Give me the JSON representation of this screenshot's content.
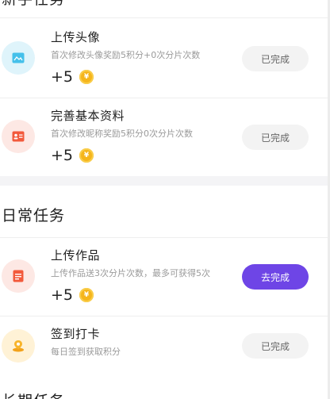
{
  "sections": {
    "newbie_title": "新手任务",
    "daily_title": "日常任务",
    "longterm_title": "长期任务"
  },
  "newbie_tasks": [
    {
      "title": "上传头像",
      "desc": "首次修改头像奖励5积分+0次分片次数",
      "reward": "+5",
      "button": "已完成",
      "icon": "image-icon",
      "status": "done"
    },
    {
      "title": "完善基本资料",
      "desc": "首次修改昵称奖励5积分0次分片次数",
      "reward": "+5",
      "button": "已完成",
      "icon": "profile-card-icon",
      "status": "done"
    }
  ],
  "daily_tasks": [
    {
      "title": "上传作品",
      "desc": "上传作品送3次分片次数，最多可获得5次",
      "reward": "+5",
      "button": "去完成",
      "icon": "document-icon",
      "status": "todo"
    },
    {
      "title": "签到打卡",
      "desc": "每日签到获取积分",
      "button": "已完成",
      "icon": "checkin-pin-icon",
      "status": "done"
    }
  ],
  "coin_symbol": "¥",
  "colors": {
    "accent": "#6e45e6",
    "coin": "#f5b51c",
    "done_button_bg": "#f3f3f3",
    "section_gap": "#f4f4f6"
  }
}
